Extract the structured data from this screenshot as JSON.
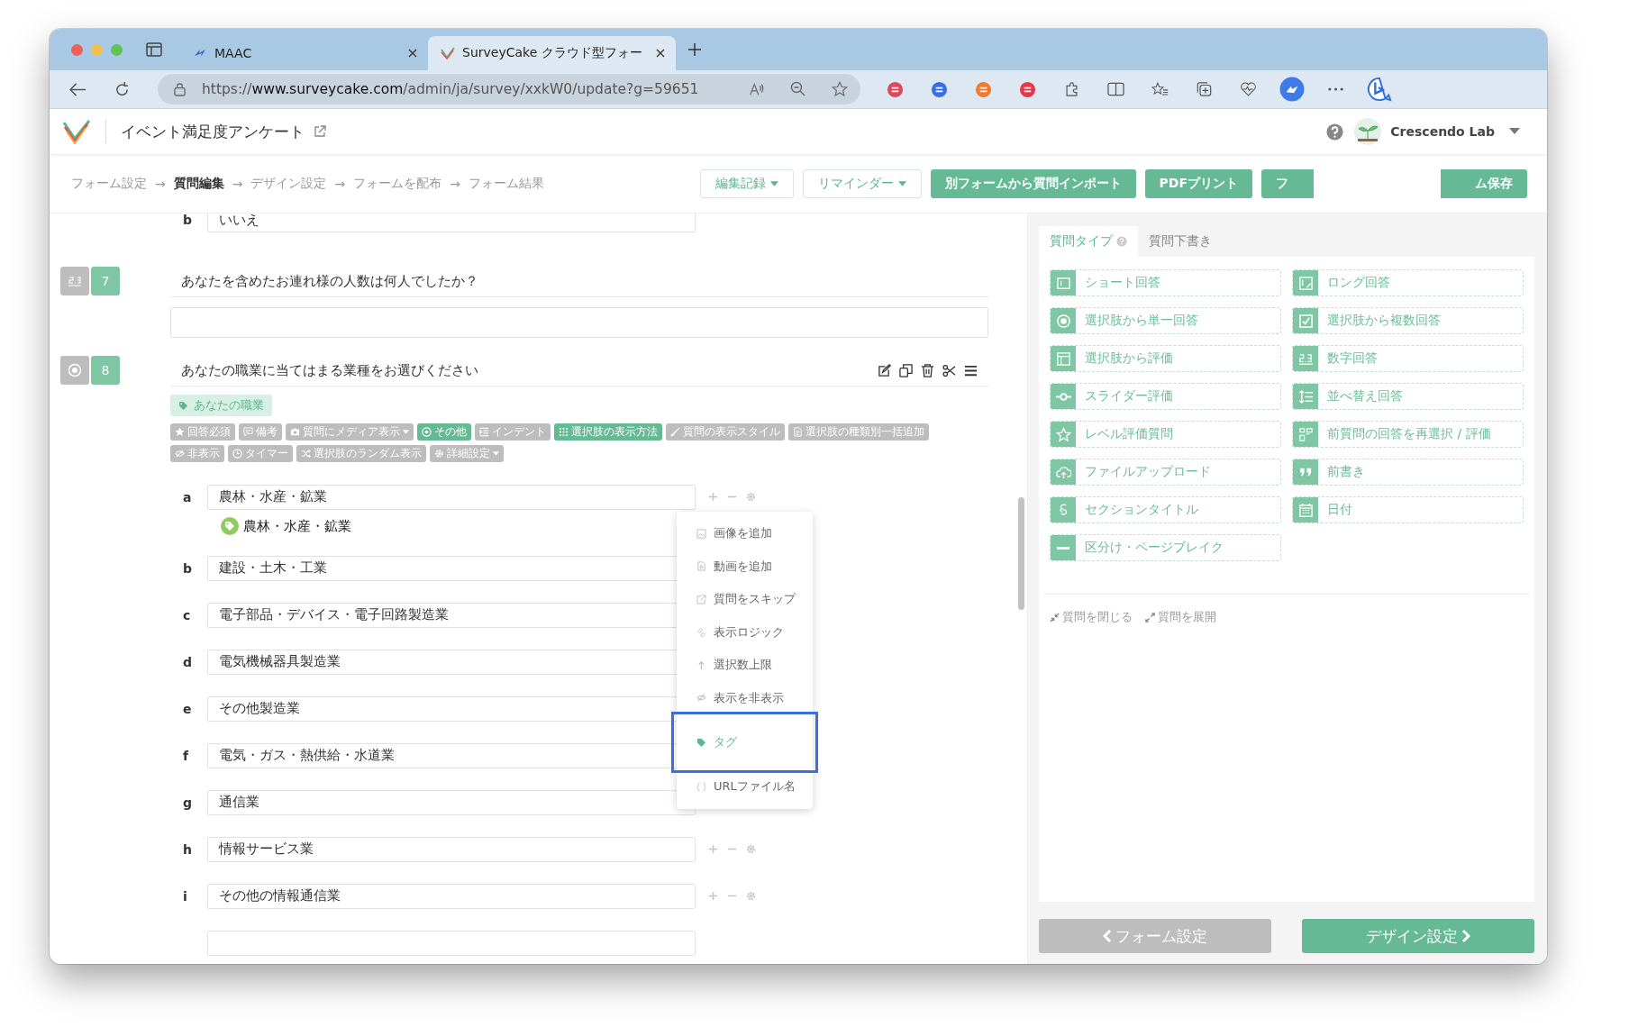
{
  "browser": {
    "tabs": [
      {
        "title": "MAAC",
        "selected": false
      },
      {
        "title": "SurveyCake クラウド型フォー",
        "selected": true
      }
    ],
    "url": "https://**www.surveycake.com**/admin/ja/survey/xxkW0/update?g=59651"
  },
  "header": {
    "title": "イベント満足度アンケート",
    "account": "Crescendo Lab"
  },
  "steps": [
    {
      "label": "フォーム設定",
      "selected": false
    },
    {
      "label": "質問編集",
      "selected": true
    },
    {
      "label": "デザイン設定",
      "selected": false
    },
    {
      "label": "フォームを配布",
      "selected": false
    },
    {
      "label": "フォーム結果",
      "selected": false
    }
  ],
  "step_arrows": [
    "→",
    "→",
    "→",
    "→"
  ],
  "toolbar_buttons": [
    {
      "label": "編集記録",
      "kind": "outline",
      "dropdown": true
    },
    {
      "label": "リマインダー",
      "kind": "outline",
      "dropdown": true
    },
    {
      "label": "別フォームから質問インポート",
      "kind": "solid",
      "dropdown": false
    },
    {
      "label": "PDFプリント",
      "kind": "solid",
      "dropdown": false
    },
    {
      "label": "フ",
      "kind": "cut_right",
      "dropdown": false
    },
    {
      "label": "ム保存",
      "kind": "cut_left",
      "dropdown": false
    }
  ],
  "editor": {
    "prev_option": {
      "letter": "b",
      "value": "いいえ"
    },
    "questions": [
      {
        "number": "7",
        "kind": "number",
        "text": "あなたを含めたお連れ様の人数は何人でしたか？"
      },
      {
        "number": "8",
        "kind": "single",
        "text": "あなたの職業に当てはまる業種をお選びください",
        "tag": "あなたの職業",
        "settings": [
          {
            "label": "回答必須",
            "kind": "required",
            "on": false,
            "dropdown": false
          },
          {
            "label": "備考",
            "kind": "note",
            "on": false,
            "dropdown": false
          },
          {
            "label": "質問にメディア表示",
            "kind": "media",
            "on": false,
            "dropdown": true
          },
          {
            "label": "その他",
            "kind": "other",
            "on": true,
            "dropdown": false
          },
          {
            "label": "インデント",
            "kind": "indent",
            "on": false,
            "dropdown": false
          },
          {
            "label": "選択肢の表示方法",
            "kind": "layout",
            "on": true,
            "dropdown": false
          },
          {
            "label": "質問の表示スタイル",
            "kind": "style",
            "on": false,
            "dropdown": false
          },
          {
            "label": "選択肢の種類別一括追加",
            "kind": "bulk",
            "on": false,
            "dropdown": false
          },
          {
            "label": "非表示",
            "kind": "hide",
            "on": false,
            "dropdown": false
          },
          {
            "label": "タイマー",
            "kind": "timer",
            "on": false,
            "dropdown": false
          },
          {
            "label": "選択肢のランダム表示",
            "kind": "random",
            "on": false,
            "dropdown": false
          },
          {
            "label": "詳細設定",
            "kind": "advanced",
            "on": false,
            "dropdown": true
          }
        ],
        "options": [
          {
            "letter": "a",
            "value": "農林・水産・鉱業",
            "tag": "農林・水産・鉱業"
          },
          {
            "letter": "b",
            "value": "建設・土木・工業"
          },
          {
            "letter": "c",
            "value": "電子部品・デバイス・電子回路製造業"
          },
          {
            "letter": "d",
            "value": "電気機械器具製造業"
          },
          {
            "letter": "e",
            "value": "その他製造業"
          },
          {
            "letter": "f",
            "value": "電気・ガス・熱供給・水道業"
          },
          {
            "letter": "g",
            "value": "通信業"
          },
          {
            "letter": "h",
            "value": "情報サービス業"
          },
          {
            "letter": "i",
            "value": "その他の情報通信業"
          }
        ]
      }
    ]
  },
  "context_menu": {
    "items": [
      {
        "label": "画像を追加",
        "kind": "image",
        "selected": false
      },
      {
        "label": "動画を追加",
        "kind": "video",
        "selected": false
      },
      {
        "label": "質問をスキップ",
        "kind": "skip",
        "selected": false
      },
      {
        "label": "表示ロジック",
        "kind": "logic",
        "selected": false
      },
      {
        "label": "選択数上限",
        "kind": "limit",
        "selected": false
      },
      {
        "label": "表示を非表示",
        "kind": "hide",
        "selected": false
      },
      {
        "label": "タグ",
        "kind": "tag",
        "selected": true
      },
      {
        "label": "URLファイル名",
        "kind": "url",
        "selected": false
      }
    ]
  },
  "sidebar": {
    "tabs": [
      {
        "label": "質問タイプ",
        "selected": true,
        "help": true
      },
      {
        "label": "質問下書き",
        "selected": false,
        "help": false
      }
    ],
    "question_types": [
      {
        "label": "ショート回答",
        "kind": "short"
      },
      {
        "label": "ロング回答",
        "kind": "long"
      },
      {
        "label": "選択肢から単一回答",
        "kind": "single"
      },
      {
        "label": "選択肢から複数回答",
        "kind": "multiple"
      },
      {
        "label": "選択肢から評価",
        "kind": "matrix"
      },
      {
        "label": "数字回答",
        "kind": "number"
      },
      {
        "label": "スライダー評価",
        "kind": "slider"
      },
      {
        "label": "並べ替え回答",
        "kind": "sort"
      },
      {
        "label": "レベル評価質問",
        "kind": "rating"
      },
      {
        "label": "前質問の回答を再選択 / 評価",
        "kind": "reselect"
      },
      {
        "label": "ファイルアップロード",
        "kind": "upload"
      },
      {
        "label": "前書き",
        "kind": "preface"
      },
      {
        "label": "セクションタイトル",
        "kind": "section"
      },
      {
        "label": "日付",
        "kind": "date"
      },
      {
        "label": "区分け・ページブレイク",
        "kind": "pagebreak"
      }
    ],
    "collapse": "質問を閉じる",
    "expand": "質問を展開",
    "back_button": "フォーム設定",
    "next_button": "デザイン設定"
  }
}
